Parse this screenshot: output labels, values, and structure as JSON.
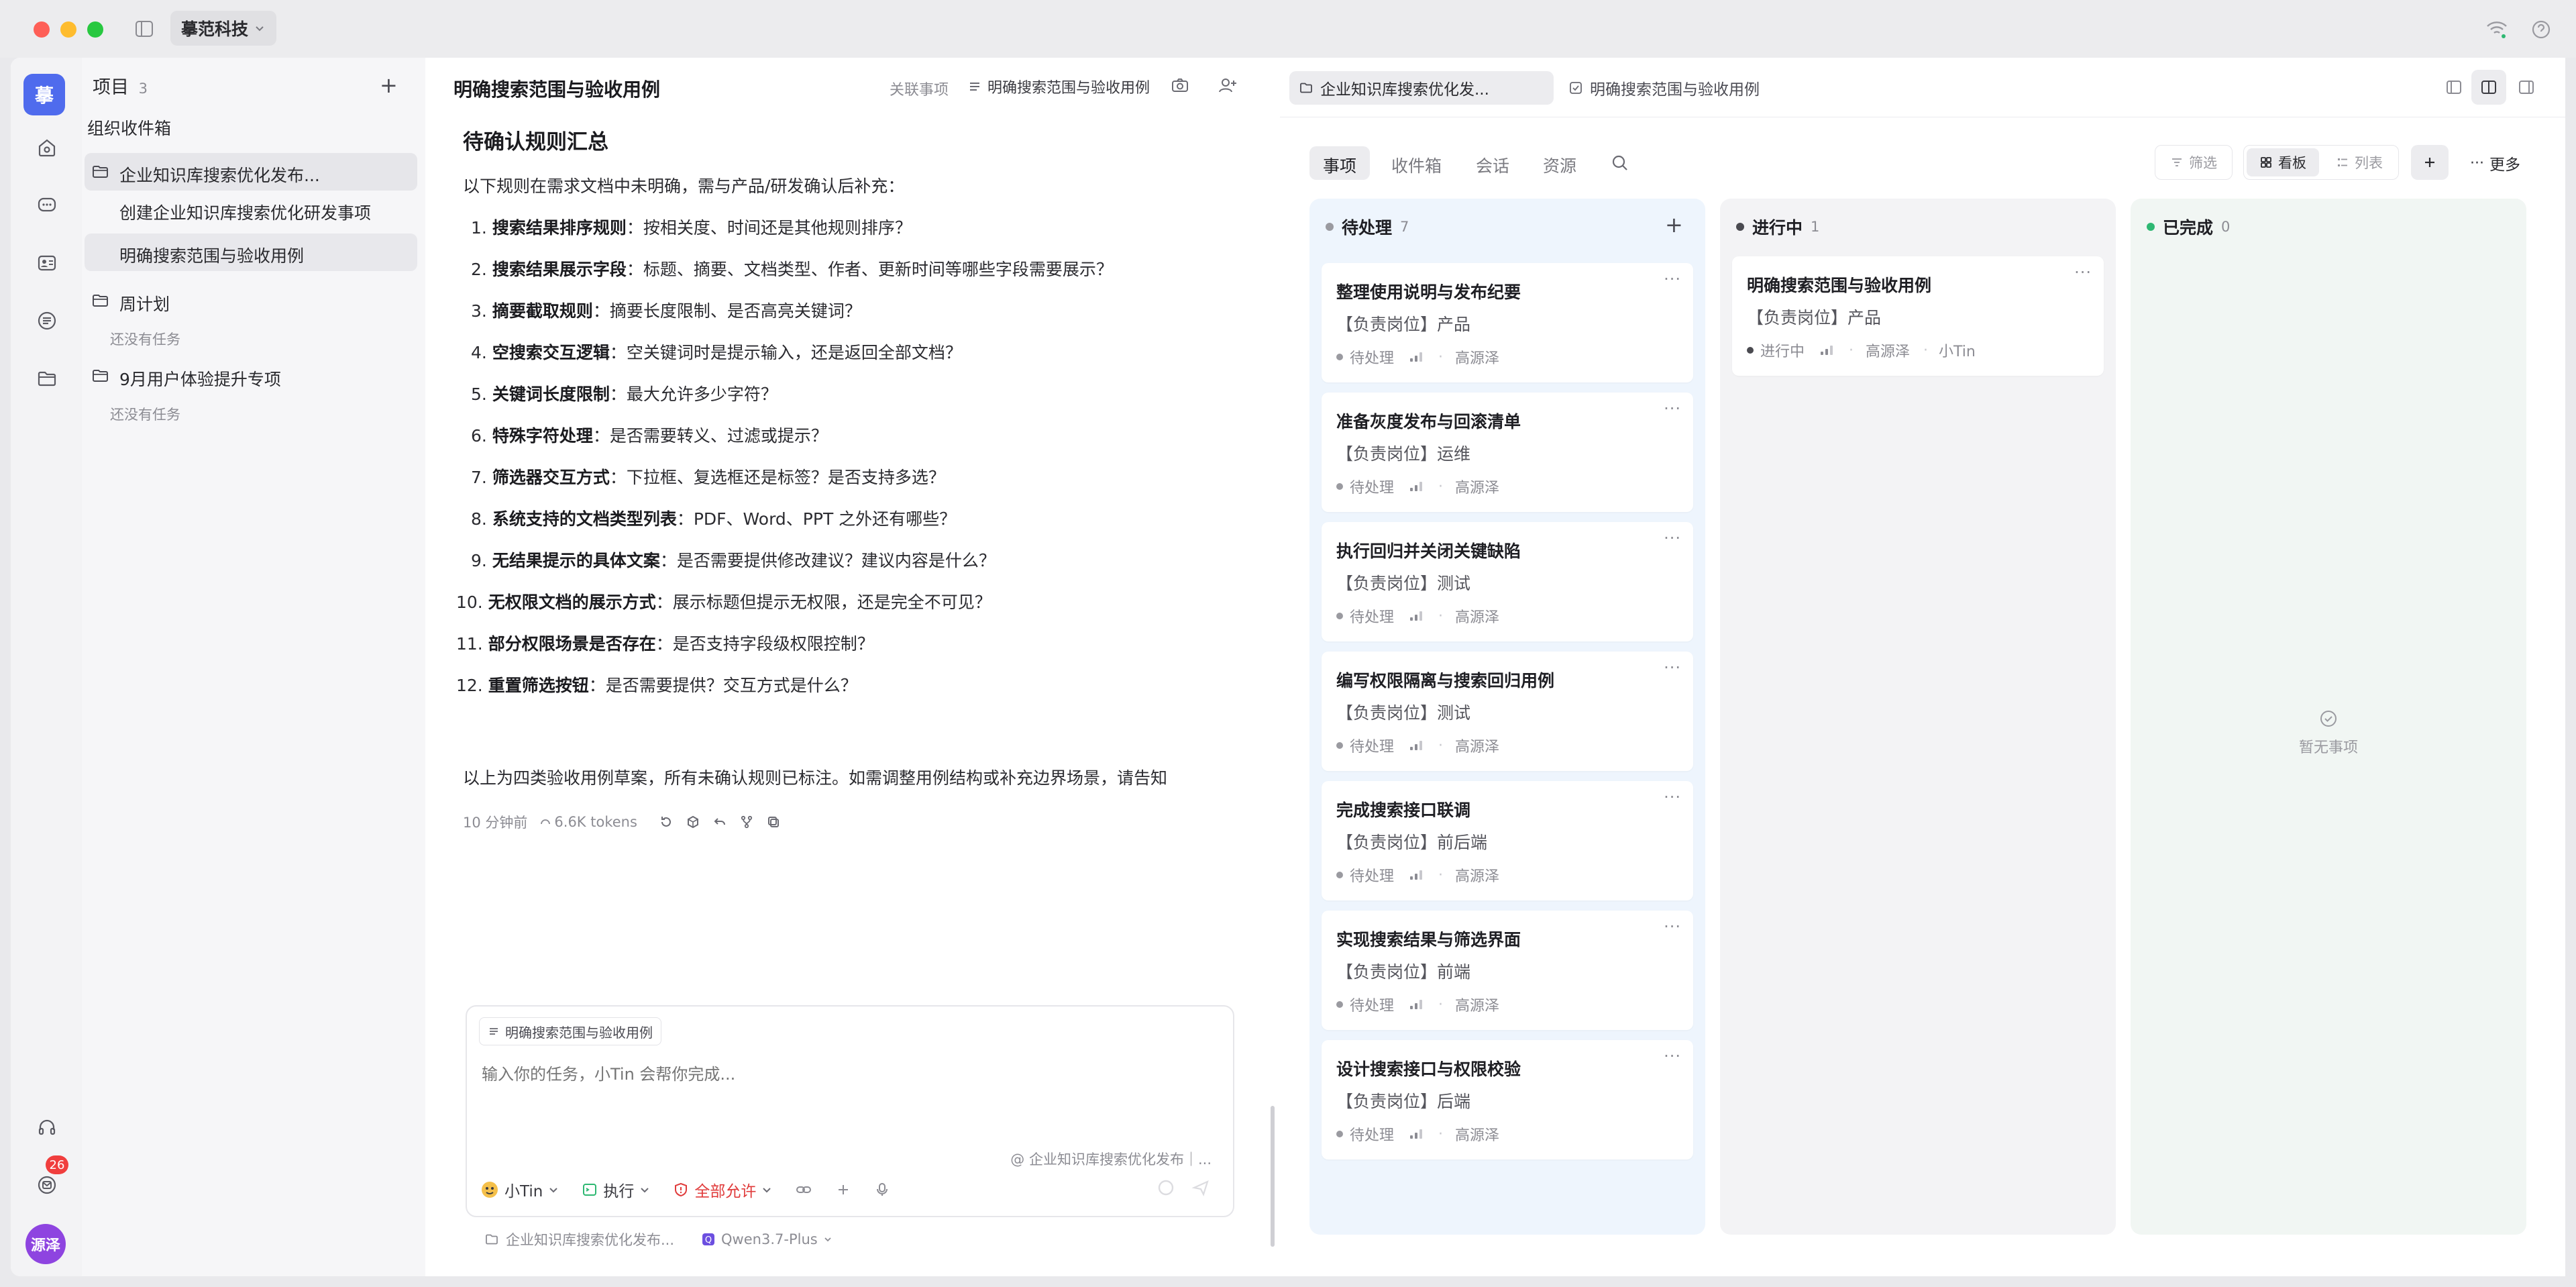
{
  "app": {
    "workspace": "摹范科技",
    "avatar_top": "摹",
    "avatar_user": "源泽",
    "mail_badge": "26",
    "accent": "#4f6bed"
  },
  "sidebar": {
    "title": "项目",
    "count": "3",
    "inbox": "组织收件箱",
    "groups": [
      {
        "label": "企业知识库搜索优化发布...",
        "children": [
          "创建企业知识库搜索优化研发事项",
          "明确搜索范围与验收用例"
        ]
      },
      {
        "label": "周计划",
        "empty": "还没有任务"
      },
      {
        "label": "9月用户体验提升专项",
        "empty": "还没有任务"
      }
    ]
  },
  "chat": {
    "title": "明确搜索范围与验收用例",
    "related_label": "关联事项",
    "related_item": "明确搜索范围与验收用例",
    "heading": "待确认规则汇总",
    "intro": "以下规则在需求文档中未明确，需与产品/研发确认后补充：",
    "rules": [
      {
        "num": "1.",
        "bold": "搜索结果排序规则",
        "text": "：按相关度、时间还是其他规则排序？"
      },
      {
        "num": "2.",
        "bold": "搜索结果展示字段",
        "text": "：标题、摘要、文档类型、作者、更新时间等哪些字段需要展示？"
      },
      {
        "num": "3.",
        "bold": "摘要截取规则",
        "text": "：摘要长度限制、是否高亮关键词？"
      },
      {
        "num": "4.",
        "bold": "空搜索交互逻辑",
        "text": "：空关键词时是提示输入，还是返回全部文档？"
      },
      {
        "num": "5.",
        "bold": "关键词长度限制",
        "text": "：最大允许多少字符？"
      },
      {
        "num": "6.",
        "bold": "特殊字符处理",
        "text": "：是否需要转义、过滤或提示？"
      },
      {
        "num": "7.",
        "bold": "筛选器交互方式",
        "text": "：下拉框、复选框还是标签？是否支持多选？"
      },
      {
        "num": "8.",
        "bold": "系统支持的文档类型列表",
        "text": "：PDF、Word、PPT 之外还有哪些？"
      },
      {
        "num": "9.",
        "bold": "无结果提示的具体文案",
        "text": "：是否需要提供修改建议？建议内容是什么？"
      },
      {
        "num": "10.",
        "bold": "无权限文档的展示方式",
        "text": "：展示标题但提示无权限，还是完全不可见？"
      },
      {
        "num": "11.",
        "bold": "部分权限场景是否存在",
        "text": "：是否支持字段级权限控制？"
      },
      {
        "num": "12.",
        "bold": "重置筛选按钮",
        "text": "：是否需要提供？交互方式是什么？"
      }
    ],
    "closing": "以上为四类验收用例草案，所有未确认规则已标注。如需调整用例结构或补充边界场景，请告知",
    "meta_time": "10 分钟前",
    "meta_tokens": "6.6K tokens",
    "composer": {
      "context_chip": "明确搜索范围与验收用例",
      "placeholder": "输入你的任务，小Tin 会帮你完成...",
      "mention": "@ 企业知识库搜索优化发布｜...",
      "agent": "小Tin",
      "mode": "执行",
      "permission": "全部允许",
      "folder": "企业知识库搜索优化发布...",
      "model": "Qwen3.7-Plus"
    }
  },
  "board": {
    "tabs_top": [
      "企业知识库搜索优化发...",
      "明确搜索范围与验收用例"
    ],
    "tabs": [
      "事项",
      "收件箱",
      "会话",
      "资源"
    ],
    "filter": "筛选",
    "view_board": "看板",
    "view_list": "列表",
    "more": "更多",
    "columns": [
      {
        "name": "待处理",
        "count": "7",
        "color": "#9a9aa0"
      },
      {
        "name": "进行中",
        "count": "1",
        "color": "#4a4a50"
      },
      {
        "name": "已完成",
        "count": "0",
        "color": "#2eb872"
      }
    ],
    "todo_cards": [
      {
        "title": "整理使用说明与发布纪要",
        "role": "【负责岗位】产品",
        "status": "待处理",
        "owner": "高源泽"
      },
      {
        "title": "准备灰度发布与回滚清单",
        "role": "【负责岗位】运维",
        "status": "待处理",
        "owner": "高源泽"
      },
      {
        "title": "执行回归并关闭关键缺陷",
        "role": "【负责岗位】测试",
        "status": "待处理",
        "owner": "高源泽"
      },
      {
        "title": "编写权限隔离与搜索回归用例",
        "role": "【负责岗位】测试",
        "status": "待处理",
        "owner": "高源泽"
      },
      {
        "title": "完成搜索接口联调",
        "role": "【负责岗位】前后端",
        "status": "待处理",
        "owner": "高源泽"
      },
      {
        "title": "实现搜索结果与筛选界面",
        "role": "【负责岗位】前端",
        "status": "待处理",
        "owner": "高源泽"
      },
      {
        "title": "设计搜索接口与权限校验",
        "role": "【负责岗位】后端",
        "status": "待处理",
        "owner": "高源泽"
      }
    ],
    "doing_cards": [
      {
        "title": "明确搜索范围与验收用例",
        "role": "【负责岗位】产品",
        "status": "进行中",
        "owner": "高源泽",
        "assignee": "小Tin"
      }
    ],
    "empty_done": "暂无事项"
  }
}
